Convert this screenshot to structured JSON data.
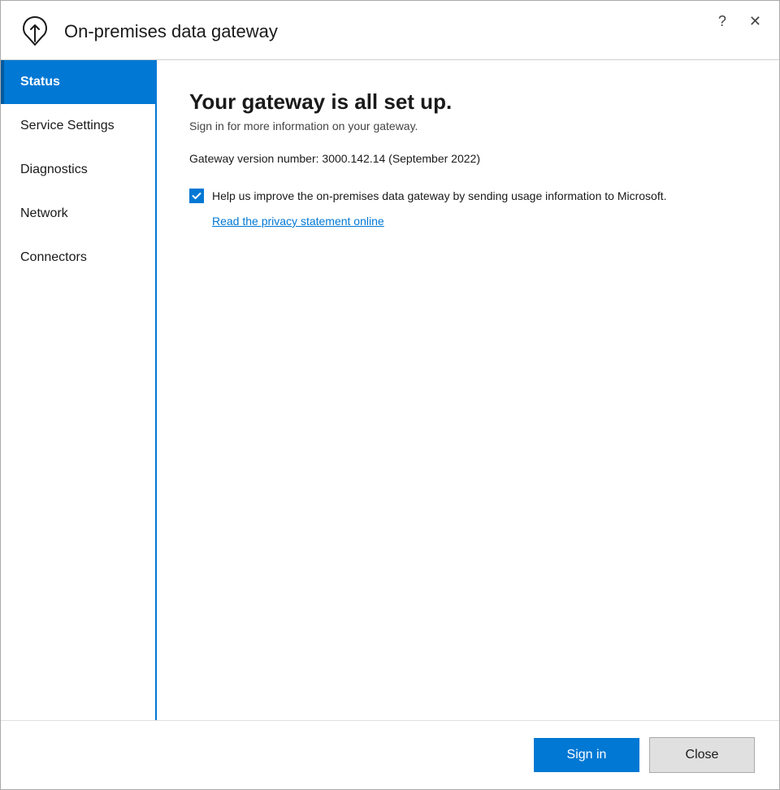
{
  "window": {
    "title": "On-premises data gateway",
    "controls": {
      "help_label": "?",
      "close_label": "✕"
    }
  },
  "sidebar": {
    "items": [
      {
        "id": "status",
        "label": "Status",
        "active": true
      },
      {
        "id": "service-settings",
        "label": "Service Settings",
        "active": false
      },
      {
        "id": "diagnostics",
        "label": "Diagnostics",
        "active": false
      },
      {
        "id": "network",
        "label": "Network",
        "active": false
      },
      {
        "id": "connectors",
        "label": "Connectors",
        "active": false
      }
    ]
  },
  "status": {
    "heading": "Your gateway is all set up.",
    "subtitle": "Sign in for more information on your gateway.",
    "version_label": "Gateway version number: 3000.142.14 (September 2022)",
    "checkbox_label": "Help us improve the on-premises data gateway by sending usage information to Microsoft.",
    "privacy_link": "Read the privacy statement online"
  },
  "footer": {
    "signin_label": "Sign in",
    "close_label": "Close"
  },
  "colors": {
    "accent": "#0078d4",
    "active_nav_bg": "#0078d4",
    "active_nav_text": "#ffffff"
  }
}
